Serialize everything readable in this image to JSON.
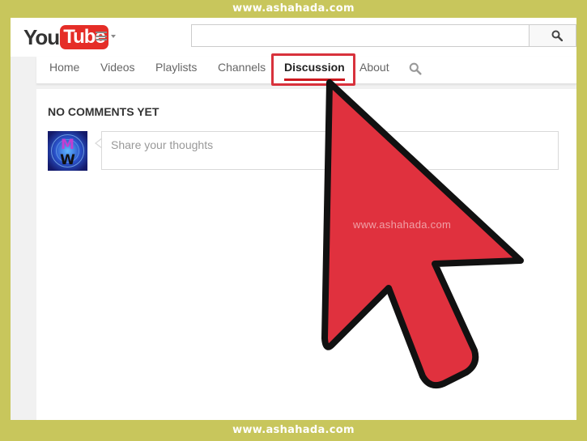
{
  "watermark": {
    "top": "www.ashahada.com",
    "bottom": "www.ashahada.com",
    "center": "www.ashahada.com"
  },
  "masthead": {
    "logo_you": "You",
    "logo_tube": "Tube",
    "search_value": "",
    "search_icon": "search-icon",
    "guide_icon": "hamburger-menu-icon"
  },
  "tabs": {
    "items": [
      {
        "label": "Home"
      },
      {
        "label": "Videos"
      },
      {
        "label": "Playlists"
      },
      {
        "label": "Channels"
      },
      {
        "label": "Discussion",
        "active": true
      },
      {
        "label": "About"
      }
    ],
    "search_icon": "search-icon"
  },
  "discussion": {
    "heading": "NO COMMENTS YET",
    "comment_placeholder": "Share your thoughts",
    "avatar_letters": [
      "M",
      "W"
    ]
  },
  "colors": {
    "brand_red": "#e52d27",
    "active_underline": "#cc181e",
    "highlight": "#d8323c",
    "arrow_fill": "#e0313e",
    "frame": "#c8c65c"
  }
}
